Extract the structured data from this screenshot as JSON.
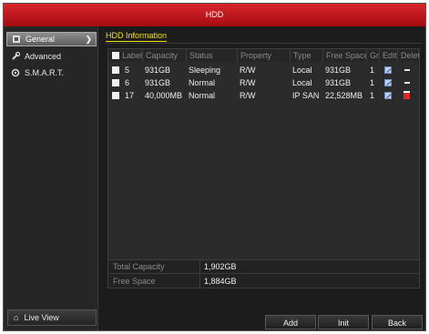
{
  "window": {
    "title": "HDD"
  },
  "sidebar": {
    "items": [
      {
        "label": "General",
        "icon": "gear-icon",
        "active": true
      },
      {
        "label": "Advanced",
        "icon": "wrench-icon",
        "active": false
      },
      {
        "label": "S.M.A.R.T.",
        "icon": "settings-icon",
        "active": false
      }
    ],
    "live_view": "Live View"
  },
  "tab": {
    "label": "HDD Information"
  },
  "table": {
    "columns": [
      "Label",
      "Capacity",
      "Status",
      "Property",
      "Type",
      "Free Space",
      "Group",
      "Edit",
      "Delete"
    ],
    "rows": [
      {
        "label": "5",
        "capacity": "931GB",
        "status": "Sleeping",
        "property": "R/W",
        "type": "Local",
        "free": "931GB",
        "group": "1",
        "delete": "dash"
      },
      {
        "label": "6",
        "capacity": "931GB",
        "status": "Normal",
        "property": "R/W",
        "type": "Local",
        "free": "931GB",
        "group": "1",
        "delete": "dash"
      },
      {
        "label": "17",
        "capacity": "40,000MB",
        "status": "Normal",
        "property": "R/W",
        "type": "IP SAN",
        "free": "22,528MB",
        "group": "1",
        "delete": "trash"
      }
    ]
  },
  "summary": {
    "total_capacity_label": "Total Capacity",
    "total_capacity": "1,902GB",
    "free_space_label": "Free Space",
    "free_space": "1,884GB"
  },
  "buttons": {
    "add": "Add",
    "init": "Init",
    "back": "Back"
  }
}
